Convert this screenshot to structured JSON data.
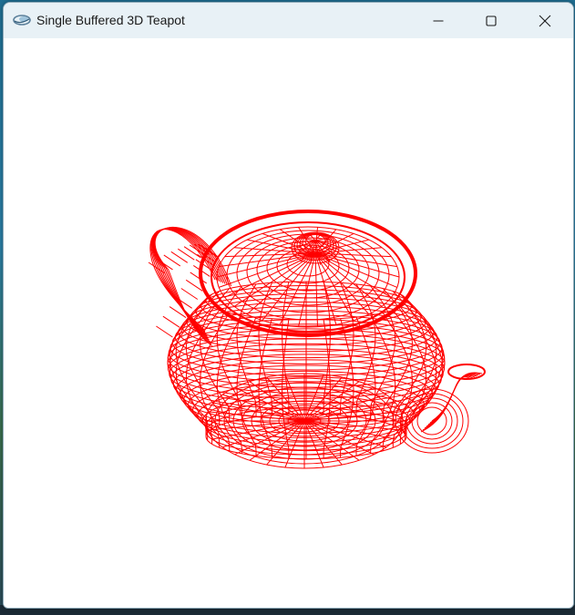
{
  "window": {
    "title": "Single Buffered 3D Teapot",
    "app_icon": "opengl-app-icon",
    "controls": {
      "minimize": "minimize-icon",
      "maximize": "maximize-icon",
      "close": "close-icon"
    }
  },
  "canvas": {
    "background": "#ffffff",
    "wire_color": "#ff0000",
    "object": "teapot-wireframe"
  }
}
